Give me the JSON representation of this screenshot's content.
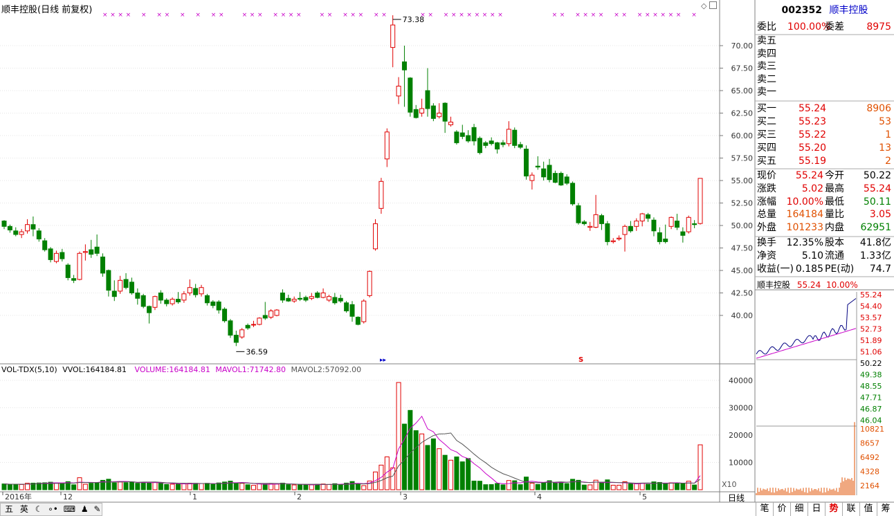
{
  "header": {
    "title": "顺丰控股(日线 前复权)"
  },
  "chart_data": {
    "type": "candlestick",
    "title": "顺丰控股(日线 前复权)",
    "period": "日线",
    "y_ticks": [
      "70.00",
      "67.50",
      "65.00",
      "62.50",
      "60.00",
      "57.50",
      "55.00",
      "52.50",
      "50.00",
      "47.50",
      "45.00",
      "42.50",
      "40.00"
    ],
    "ylim": [
      36.0,
      74.0
    ],
    "x_labels": [
      "2016年",
      "12",
      "1",
      "2",
      "3",
      "4",
      "5"
    ],
    "high_label": "73.38",
    "low_label": "36.59",
    "special_markers": [
      "S"
    ],
    "candles": [
      {
        "o": 50.5,
        "h": 50.6,
        "c": 49.9,
        "l": 49.6
      },
      {
        "o": 49.9,
        "h": 50.1,
        "c": 49.5,
        "l": 49.2
      },
      {
        "o": 49.4,
        "h": 49.8,
        "c": 49.0,
        "l": 48.8
      },
      {
        "o": 49.0,
        "h": 49.6,
        "c": 49.3,
        "l": 48.6
      },
      {
        "o": 49.4,
        "h": 50.7,
        "c": 50.1,
        "l": 49.1
      },
      {
        "o": 50.1,
        "h": 51.0,
        "c": 49.6,
        "l": 48.8
      },
      {
        "o": 49.4,
        "h": 49.7,
        "c": 48.5,
        "l": 48.2
      },
      {
        "o": 48.3,
        "h": 48.6,
        "c": 47.3,
        "l": 47.1
      },
      {
        "o": 47.4,
        "h": 47.6,
        "c": 46.2,
        "l": 45.9
      },
      {
        "o": 46.0,
        "h": 47.2,
        "c": 46.9,
        "l": 45.8
      },
      {
        "o": 47.0,
        "h": 47.4,
        "c": 46.3,
        "l": 46.0
      },
      {
        "o": 45.6,
        "h": 45.8,
        "c": 44.2,
        "l": 43.9
      },
      {
        "o": 44.1,
        "h": 44.5,
        "c": 43.9,
        "l": 43.6
      },
      {
        "o": 44.0,
        "h": 47.1,
        "c": 46.9,
        "l": 43.9
      },
      {
        "o": 47.0,
        "h": 47.9,
        "c": 47.1,
        "l": 46.1
      },
      {
        "o": 47.3,
        "h": 48.4,
        "c": 46.8,
        "l": 46.4
      },
      {
        "o": 47.6,
        "h": 49.0,
        "c": 46.9,
        "l": 46.6
      },
      {
        "o": 46.5,
        "h": 46.9,
        "c": 44.7,
        "l": 44.3
      },
      {
        "o": 45.0,
        "h": 45.1,
        "c": 42.8,
        "l": 42.1
      },
      {
        "o": 42.7,
        "h": 43.9,
        "c": 42.1,
        "l": 41.6
      },
      {
        "o": 42.7,
        "h": 44.4,
        "c": 43.9,
        "l": 42.4
      },
      {
        "o": 44.0,
        "h": 44.7,
        "c": 43.1,
        "l": 42.9
      },
      {
        "o": 43.7,
        "h": 44.2,
        "c": 42.5,
        "l": 42.3
      },
      {
        "o": 42.5,
        "h": 43.0,
        "c": 41.9,
        "l": 41.2
      },
      {
        "o": 42.2,
        "h": 42.4,
        "c": 41.0,
        "l": 40.8
      },
      {
        "o": 41.0,
        "h": 41.1,
        "c": 40.3,
        "l": 39.1
      },
      {
        "o": 40.9,
        "h": 42.2,
        "c": 42.1,
        "l": 40.6
      },
      {
        "o": 42.5,
        "h": 42.8,
        "c": 41.7,
        "l": 41.3
      },
      {
        "o": 41.7,
        "h": 41.9,
        "c": 41.3,
        "l": 41.0
      },
      {
        "o": 41.3,
        "h": 42.0,
        "c": 41.8,
        "l": 41.1
      },
      {
        "o": 41.8,
        "h": 42.6,
        "c": 41.5,
        "l": 41.3
      },
      {
        "o": 41.7,
        "h": 42.7,
        "c": 42.4,
        "l": 41.4
      },
      {
        "o": 42.5,
        "h": 44.0,
        "c": 43.1,
        "l": 42.2
      },
      {
        "o": 43.0,
        "h": 43.5,
        "c": 42.3,
        "l": 42.0
      },
      {
        "o": 42.4,
        "h": 43.4,
        "c": 43.1,
        "l": 42.1
      },
      {
        "o": 42.2,
        "h": 42.4,
        "c": 41.4,
        "l": 41.1
      },
      {
        "o": 41.5,
        "h": 41.7,
        "c": 41.1,
        "l": 40.8
      },
      {
        "o": 41.5,
        "h": 41.7,
        "c": 40.6,
        "l": 40.2
      },
      {
        "o": 40.7,
        "h": 40.9,
        "c": 39.4,
        "l": 39.2
      },
      {
        "o": 39.4,
        "h": 39.6,
        "c": 37.8,
        "l": 37.5
      },
      {
        "o": 37.8,
        "h": 38.3,
        "c": 37.0,
        "l": 36.59
      },
      {
        "o": 37.6,
        "h": 38.6,
        "c": 38.4,
        "l": 37.4
      },
      {
        "o": 38.9,
        "h": 39.1,
        "c": 38.6,
        "l": 38.4
      },
      {
        "o": 39.0,
        "h": 39.4,
        "c": 39.0,
        "l": 38.7
      },
      {
        "o": 39.0,
        "h": 39.8,
        "c": 39.7,
        "l": 38.9
      },
      {
        "o": 40.0,
        "h": 41.5,
        "c": 39.7,
        "l": 39.5
      },
      {
        "o": 39.8,
        "h": 40.7,
        "c": 40.5,
        "l": 39.6
      },
      {
        "o": 40.0,
        "h": 40.7,
        "c": 40.6,
        "l": 39.9
      },
      {
        "o": 42.5,
        "h": 42.9,
        "c": 41.7,
        "l": 41.4
      },
      {
        "o": 41.9,
        "h": 42.3,
        "c": 41.6,
        "l": 41.5
      },
      {
        "o": 41.6,
        "h": 42.1,
        "c": 41.8,
        "l": 41.4
      },
      {
        "o": 41.9,
        "h": 42.6,
        "c": 41.8,
        "l": 41.6
      },
      {
        "o": 42.0,
        "h": 42.2,
        "c": 41.7,
        "l": 41.5
      },
      {
        "o": 41.9,
        "h": 42.5,
        "c": 42.1,
        "l": 41.7
      },
      {
        "o": 42.5,
        "h": 42.7,
        "c": 42.0,
        "l": 41.9
      },
      {
        "o": 42.0,
        "h": 43.0,
        "c": 42.5,
        "l": 41.9
      },
      {
        "o": 41.7,
        "h": 42.3,
        "c": 42.1,
        "l": 41.5
      },
      {
        "o": 42.0,
        "h": 42.5,
        "c": 41.4,
        "l": 41.2
      },
      {
        "o": 41.9,
        "h": 42.3,
        "c": 41.6,
        "l": 41.4
      },
      {
        "o": 41.4,
        "h": 41.6,
        "c": 40.5,
        "l": 40.3
      },
      {
        "o": 41.2,
        "h": 41.6,
        "c": 39.9,
        "l": 39.3
      },
      {
        "o": 39.8,
        "h": 39.9,
        "c": 39.0,
        "l": 38.9
      },
      {
        "o": 39.3,
        "h": 41.8,
        "c": 41.6,
        "l": 39.1
      },
      {
        "o": 42.2,
        "h": 45.0,
        "c": 44.9,
        "l": 42.0
      },
      {
        "o": 47.4,
        "h": 50.7,
        "c": 50.2,
        "l": 47.2
      },
      {
        "o": 51.9,
        "h": 55.3,
        "c": 54.9,
        "l": 51.3
      },
      {
        "o": 57.4,
        "h": 60.8,
        "c": 60.4,
        "l": 56.5
      },
      {
        "o": 69.8,
        "h": 73.38,
        "c": 72.3,
        "l": 67.6
      },
      {
        "o": 64.4,
        "h": 66.5,
        "c": 65.5,
        "l": 63.5
      },
      {
        "o": 68.2,
        "h": 70.0,
        "c": 67.3,
        "l": 63.2
      },
      {
        "o": 66.4,
        "h": 66.5,
        "c": 62.6,
        "l": 62.1
      },
      {
        "o": 62.9,
        "h": 63.4,
        "c": 62.0,
        "l": 61.9
      },
      {
        "o": 62.5,
        "h": 64.1,
        "c": 63.0,
        "l": 62.1
      },
      {
        "o": 65.0,
        "h": 67.5,
        "c": 63.0,
        "l": 62.1
      },
      {
        "o": 63.3,
        "h": 63.6,
        "c": 61.9,
        "l": 61.6
      },
      {
        "o": 62.1,
        "h": 63.6,
        "c": 62.5,
        "l": 61.9
      },
      {
        "o": 63.6,
        "h": 63.7,
        "c": 61.6,
        "l": 60.3
      },
      {
        "o": 61.2,
        "h": 62.1,
        "c": 61.5,
        "l": 61.0
      },
      {
        "o": 60.4,
        "h": 60.6,
        "c": 59.2,
        "l": 59.0
      },
      {
        "o": 60.3,
        "h": 61.2,
        "c": 59.9,
        "l": 59.6
      },
      {
        "o": 60.0,
        "h": 60.6,
        "c": 59.4,
        "l": 59.2
      },
      {
        "o": 60.9,
        "h": 61.3,
        "c": 59.4,
        "l": 58.9
      },
      {
        "o": 59.7,
        "h": 59.9,
        "c": 58.1,
        "l": 57.9
      },
      {
        "o": 59.2,
        "h": 59.4,
        "c": 58.9,
        "l": 58.6
      },
      {
        "o": 59.4,
        "h": 59.8,
        "c": 59.1,
        "l": 58.9
      },
      {
        "o": 59.2,
        "h": 59.3,
        "c": 58.5,
        "l": 58.0
      },
      {
        "o": 59.2,
        "h": 59.5,
        "c": 59.0,
        "l": 58.7
      },
      {
        "o": 59.1,
        "h": 61.6,
        "c": 60.7,
        "l": 58.8
      },
      {
        "o": 60.6,
        "h": 60.9,
        "c": 58.9,
        "l": 58.6
      },
      {
        "o": 59.0,
        "h": 59.3,
        "c": 58.7,
        "l": 58.5
      },
      {
        "o": 58.5,
        "h": 58.9,
        "c": 55.5,
        "l": 55.1
      },
      {
        "o": 55.0,
        "h": 55.9,
        "c": 55.6,
        "l": 54.0
      },
      {
        "o": 56.6,
        "h": 57.7,
        "c": 56.5,
        "l": 56.2
      },
      {
        "o": 56.3,
        "h": 57.1,
        "c": 55.4,
        "l": 55.0
      },
      {
        "o": 56.7,
        "h": 57.4,
        "c": 55.1,
        "l": 54.8
      },
      {
        "o": 55.8,
        "h": 56.1,
        "c": 54.8,
        "l": 54.7
      },
      {
        "o": 55.8,
        "h": 56.0,
        "c": 54.5,
        "l": 54.4
      },
      {
        "o": 55.4,
        "h": 55.7,
        "c": 54.7,
        "l": 54.5
      },
      {
        "o": 54.7,
        "h": 54.9,
        "c": 52.4,
        "l": 52.2
      },
      {
        "o": 52.2,
        "h": 52.5,
        "c": 50.3,
        "l": 50.1
      },
      {
        "o": 50.4,
        "h": 50.6,
        "c": 50.2,
        "l": 50.0
      },
      {
        "o": 49.8,
        "h": 50.4,
        "c": 49.9,
        "l": 49.4
      },
      {
        "o": 49.8,
        "h": 53.4,
        "c": 51.2,
        "l": 49.7
      },
      {
        "o": 51.1,
        "h": 51.3,
        "c": 50.2,
        "l": 49.5
      },
      {
        "o": 50.2,
        "h": 50.5,
        "c": 48.2,
        "l": 47.8
      },
      {
        "o": 48.2,
        "h": 48.6,
        "c": 48.3,
        "l": 48.0
      },
      {
        "o": 48.5,
        "h": 48.9,
        "c": 48.6,
        "l": 48.3
      },
      {
        "o": 49.0,
        "h": 50.1,
        "c": 49.9,
        "l": 47.1
      },
      {
        "o": 49.9,
        "h": 50.5,
        "c": 49.4,
        "l": 49.2
      },
      {
        "o": 49.9,
        "h": 50.8,
        "c": 50.5,
        "l": 49.4
      },
      {
        "o": 50.5,
        "h": 51.4,
        "c": 51.3,
        "l": 49.9
      },
      {
        "o": 51.2,
        "h": 51.4,
        "c": 50.8,
        "l": 50.4
      },
      {
        "o": 50.6,
        "h": 50.9,
        "c": 49.4,
        "l": 48.8
      },
      {
        "o": 49.2,
        "h": 49.8,
        "c": 48.2,
        "l": 47.9
      },
      {
        "o": 48.5,
        "h": 50.1,
        "c": 48.2,
        "l": 48.0
      },
      {
        "o": 49.9,
        "h": 51.0,
        "c": 50.9,
        "l": 49.6
      },
      {
        "o": 50.5,
        "h": 51.3,
        "c": 49.8,
        "l": 49.5
      },
      {
        "o": 49.3,
        "h": 49.8,
        "c": 48.9,
        "l": 48.1
      },
      {
        "o": 49.3,
        "h": 51.1,
        "c": 50.9,
        "l": 49.1
      },
      {
        "o": 50.2,
        "h": 50.6,
        "c": 50.1,
        "l": 49.7
      },
      {
        "o": 50.22,
        "h": 55.24,
        "c": 55.24,
        "l": 50.11
      }
    ],
    "volume": {
      "indicator": "VOL-TDX(5,10)",
      "vvol_label": "VVOL:",
      "vvol": "164184.81",
      "volume_label": "VOLUME:",
      "volume": "164184.81",
      "mavol1_label": "MAVOL1:",
      "mavol1": "71742.80",
      "mavol2_label": "MAVOL2:",
      "mavol2": "57092.00",
      "y_ticks": [
        "40000",
        "30000",
        "20000",
        "10000"
      ],
      "ylim": [
        0,
        44000
      ],
      "scale_label": "X10"
    }
  },
  "quote": {
    "code": "002352",
    "name": "顺丰控股",
    "weibi_label": "委比",
    "weibi": "100.00%",
    "weicha_label": "委差",
    "weicha": "8975",
    "asks": [
      {
        "label": "卖五"
      },
      {
        "label": "卖四"
      },
      {
        "label": "卖三"
      },
      {
        "label": "卖二"
      },
      {
        "label": "卖一"
      }
    ],
    "bids": [
      {
        "label": "买一",
        "price": "55.24",
        "vol": "8906"
      },
      {
        "label": "买二",
        "price": "55.23",
        "vol": "53"
      },
      {
        "label": "买三",
        "price": "55.22",
        "vol": "1"
      },
      {
        "label": "买四",
        "price": "55.20",
        "vol": "13"
      },
      {
        "label": "买五",
        "price": "55.19",
        "vol": "2"
      }
    ],
    "stats": [
      {
        "l1": "现价",
        "v1": "55.24",
        "l2": "今开",
        "v2": "50.22"
      },
      {
        "l1": "涨跌",
        "v1": "5.02",
        "l2": "最高",
        "v2": "55.24"
      },
      {
        "l1": "涨幅",
        "v1": "10.00%",
        "l2": "最低",
        "v2": "50.11"
      },
      {
        "l1": "总量",
        "v1": "164184",
        "l2": "量比",
        "v2": "3.05"
      },
      {
        "l1": "外盘",
        "v1": "101233",
        "l2": "内盘",
        "v2": "62951"
      }
    ],
    "stats2": [
      {
        "l1": "换手",
        "v1": "12.35%",
        "l2": "股本",
        "v2": "41.8亿"
      },
      {
        "l1": "净资",
        "v1": "5.10",
        "l2": "流通",
        "v2": "1.33亿"
      },
      {
        "l1": "收益(一)",
        "v1": "0.185",
        "l2": "PE(动)",
        "v2": "74.7"
      }
    ]
  },
  "mini_chart": {
    "title": "顺丰控股",
    "price": "55.24",
    "pct": "10.00%",
    "price_ticks": [
      "55.24",
      "54.40",
      "53.57",
      "52.73",
      "51.89",
      "51.06",
      "50.22",
      "49.38",
      "48.55",
      "47.71",
      "46.87",
      "46.04"
    ],
    "vol_ticks": [
      "10821",
      "8657",
      "6492",
      "4328",
      "2164"
    ]
  },
  "bottom_bar": {
    "ime": [
      "五",
      "英"
    ],
    "period": "日线",
    "tabs": [
      "笔",
      "价",
      "细",
      "日",
      "势",
      "联",
      "值",
      "筹"
    ]
  }
}
